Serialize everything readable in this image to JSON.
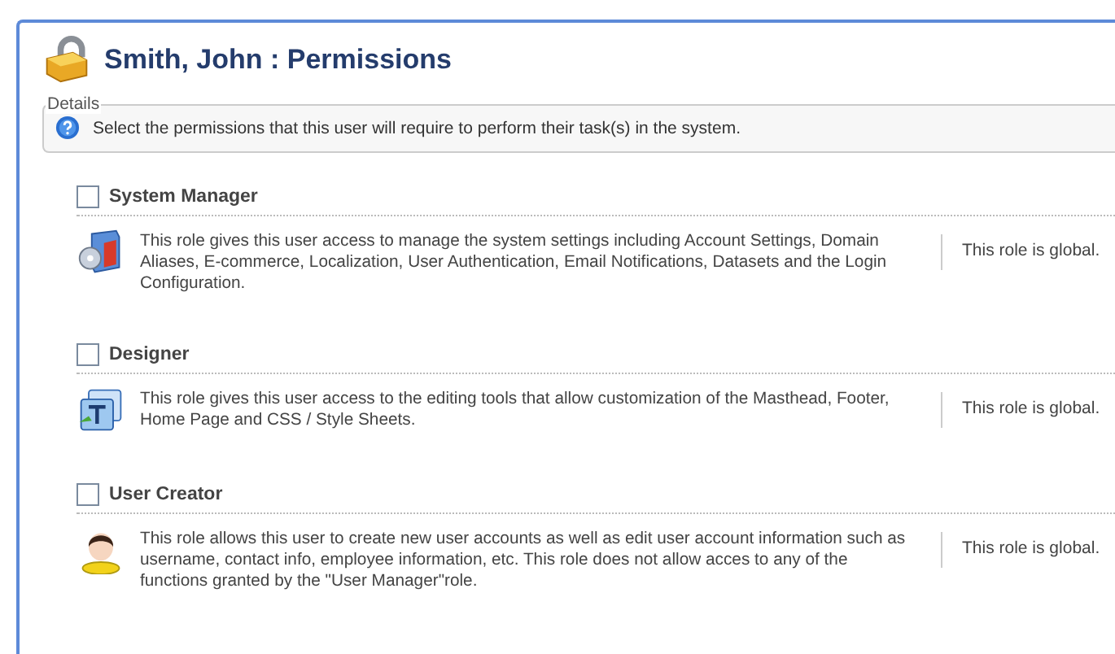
{
  "title": "Smith, John : Permissions",
  "details": {
    "legend": "Details",
    "text": "Select the permissions that this user will require to perform their task(s) in the system."
  },
  "roles": [
    {
      "name": "System Manager",
      "checked": false,
      "kind": "system",
      "description": "This role gives this user access to manage the system settings including Account Settings, Domain Aliases, E-commerce, Localization, User Authentication, Email Notifications, Datasets and the Login Configuration.",
      "scope": "This role is global."
    },
    {
      "name": "Designer",
      "checked": false,
      "kind": "designer",
      "description": "This role gives this user access to the editing tools that allow customization of the Masthead, Footer, Home Page and CSS / Style Sheets.",
      "scope": "This role is global."
    },
    {
      "name": "User Creator",
      "checked": false,
      "kind": "user",
      "description": "This role allows this user to create new user accounts as well as edit user account information such as username, contact info, employee information, etc. This role does not allow acces to any of the functions granted by the \"User Manager\"role.",
      "scope": "This role is global."
    }
  ]
}
